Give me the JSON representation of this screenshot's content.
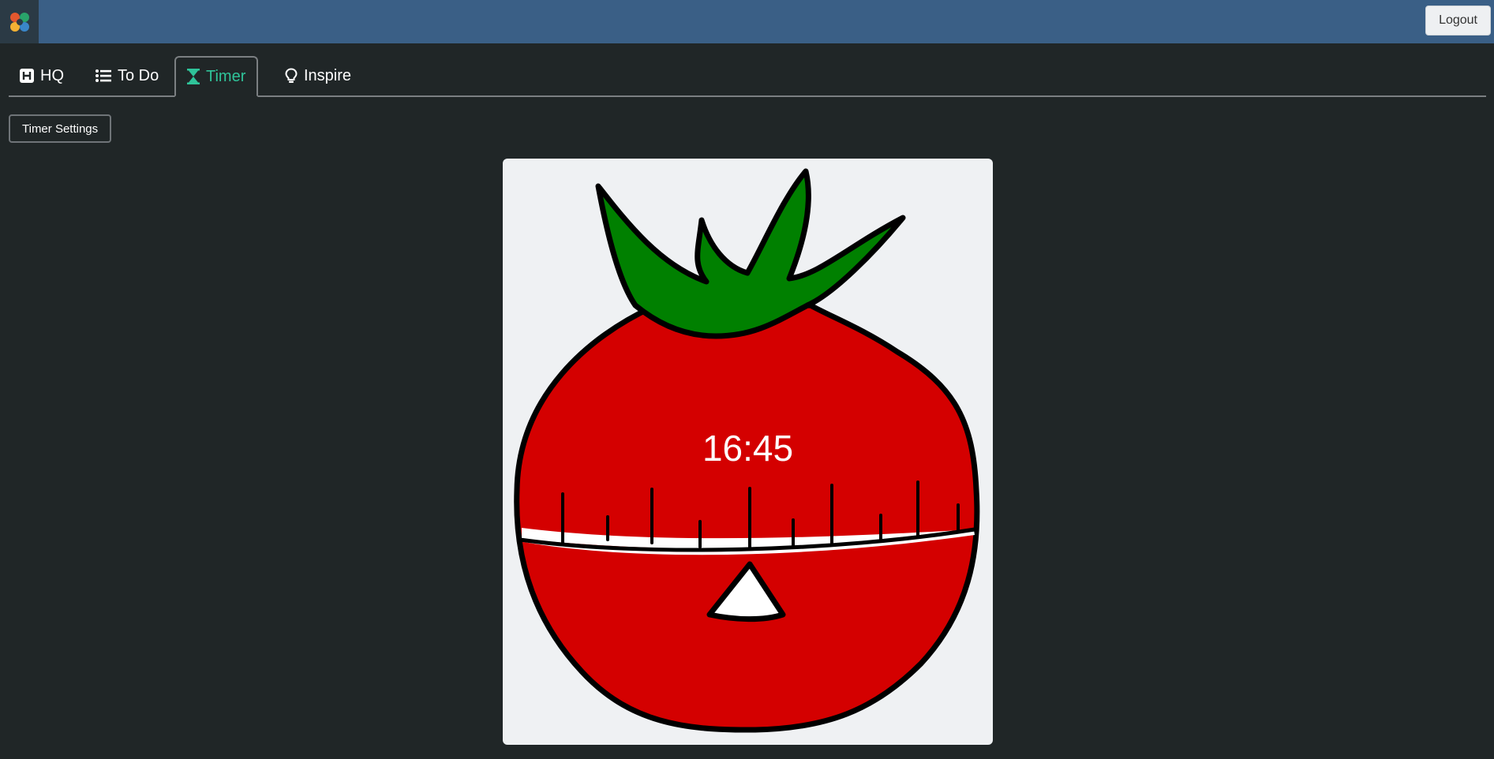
{
  "header": {
    "logo_icon": "app-logo-icon",
    "logout_label": "Logout",
    "background": "#3a5f86"
  },
  "tabs": [
    {
      "label": "HQ",
      "icon": "hq-icon",
      "active": false
    },
    {
      "label": "To Do",
      "icon": "list-icon",
      "active": false
    },
    {
      "label": "Timer",
      "icon": "hourglass-icon",
      "active": true
    },
    {
      "label": "Inspire",
      "icon": "lightbulb-icon",
      "active": false
    }
  ],
  "timer": {
    "settings_label": "Timer Settings",
    "time": "16:45",
    "accent_color": "#2fc49a",
    "tomato_color": "#d40000",
    "leaf_color": "#008000"
  }
}
